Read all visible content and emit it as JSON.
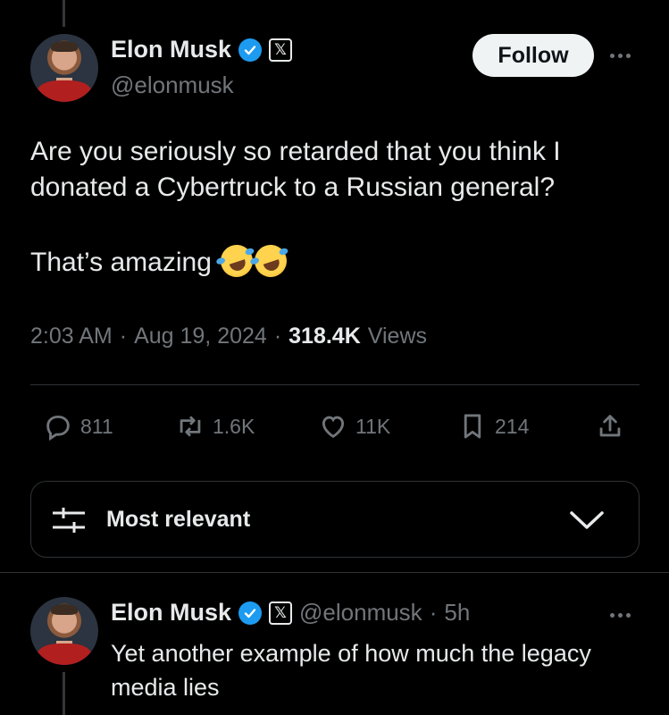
{
  "tweet": {
    "author_name": "Elon Musk",
    "handle": "@elonmusk",
    "x_badge": "𝕏",
    "follow_label": "Follow",
    "text_line1": "Are you seriously so retarded that you think I donated a Cybertruck to a Russian general?",
    "text_line2": "That’s amazing",
    "emoji_count": 2,
    "time": "2:03 AM",
    "date": "Aug 19, 2024",
    "separator": "·",
    "views_count": "318.4K",
    "views_label": "Views"
  },
  "actions": {
    "replies": "811",
    "reposts": "1.6K",
    "likes": "11K",
    "bookmarks": "214"
  },
  "sort": {
    "label": "Most relevant"
  },
  "reply": {
    "author_name": "Elon Musk",
    "x_badge": "𝕏",
    "handle": "@elonmusk",
    "separator": "·",
    "age": "5h",
    "text": "Yet another example of how much the legacy media lies"
  },
  "colors": {
    "background": "#000000",
    "text": "#e7e9ea",
    "muted": "#71767b",
    "verified": "#1d9bf0",
    "follow_button": "#eff3f4"
  },
  "icons": [
    "reply-icon",
    "repost-icon",
    "like-icon",
    "bookmark-icon",
    "share-icon",
    "filter-icon",
    "chevron-down-icon",
    "verified-icon",
    "more-icon"
  ]
}
